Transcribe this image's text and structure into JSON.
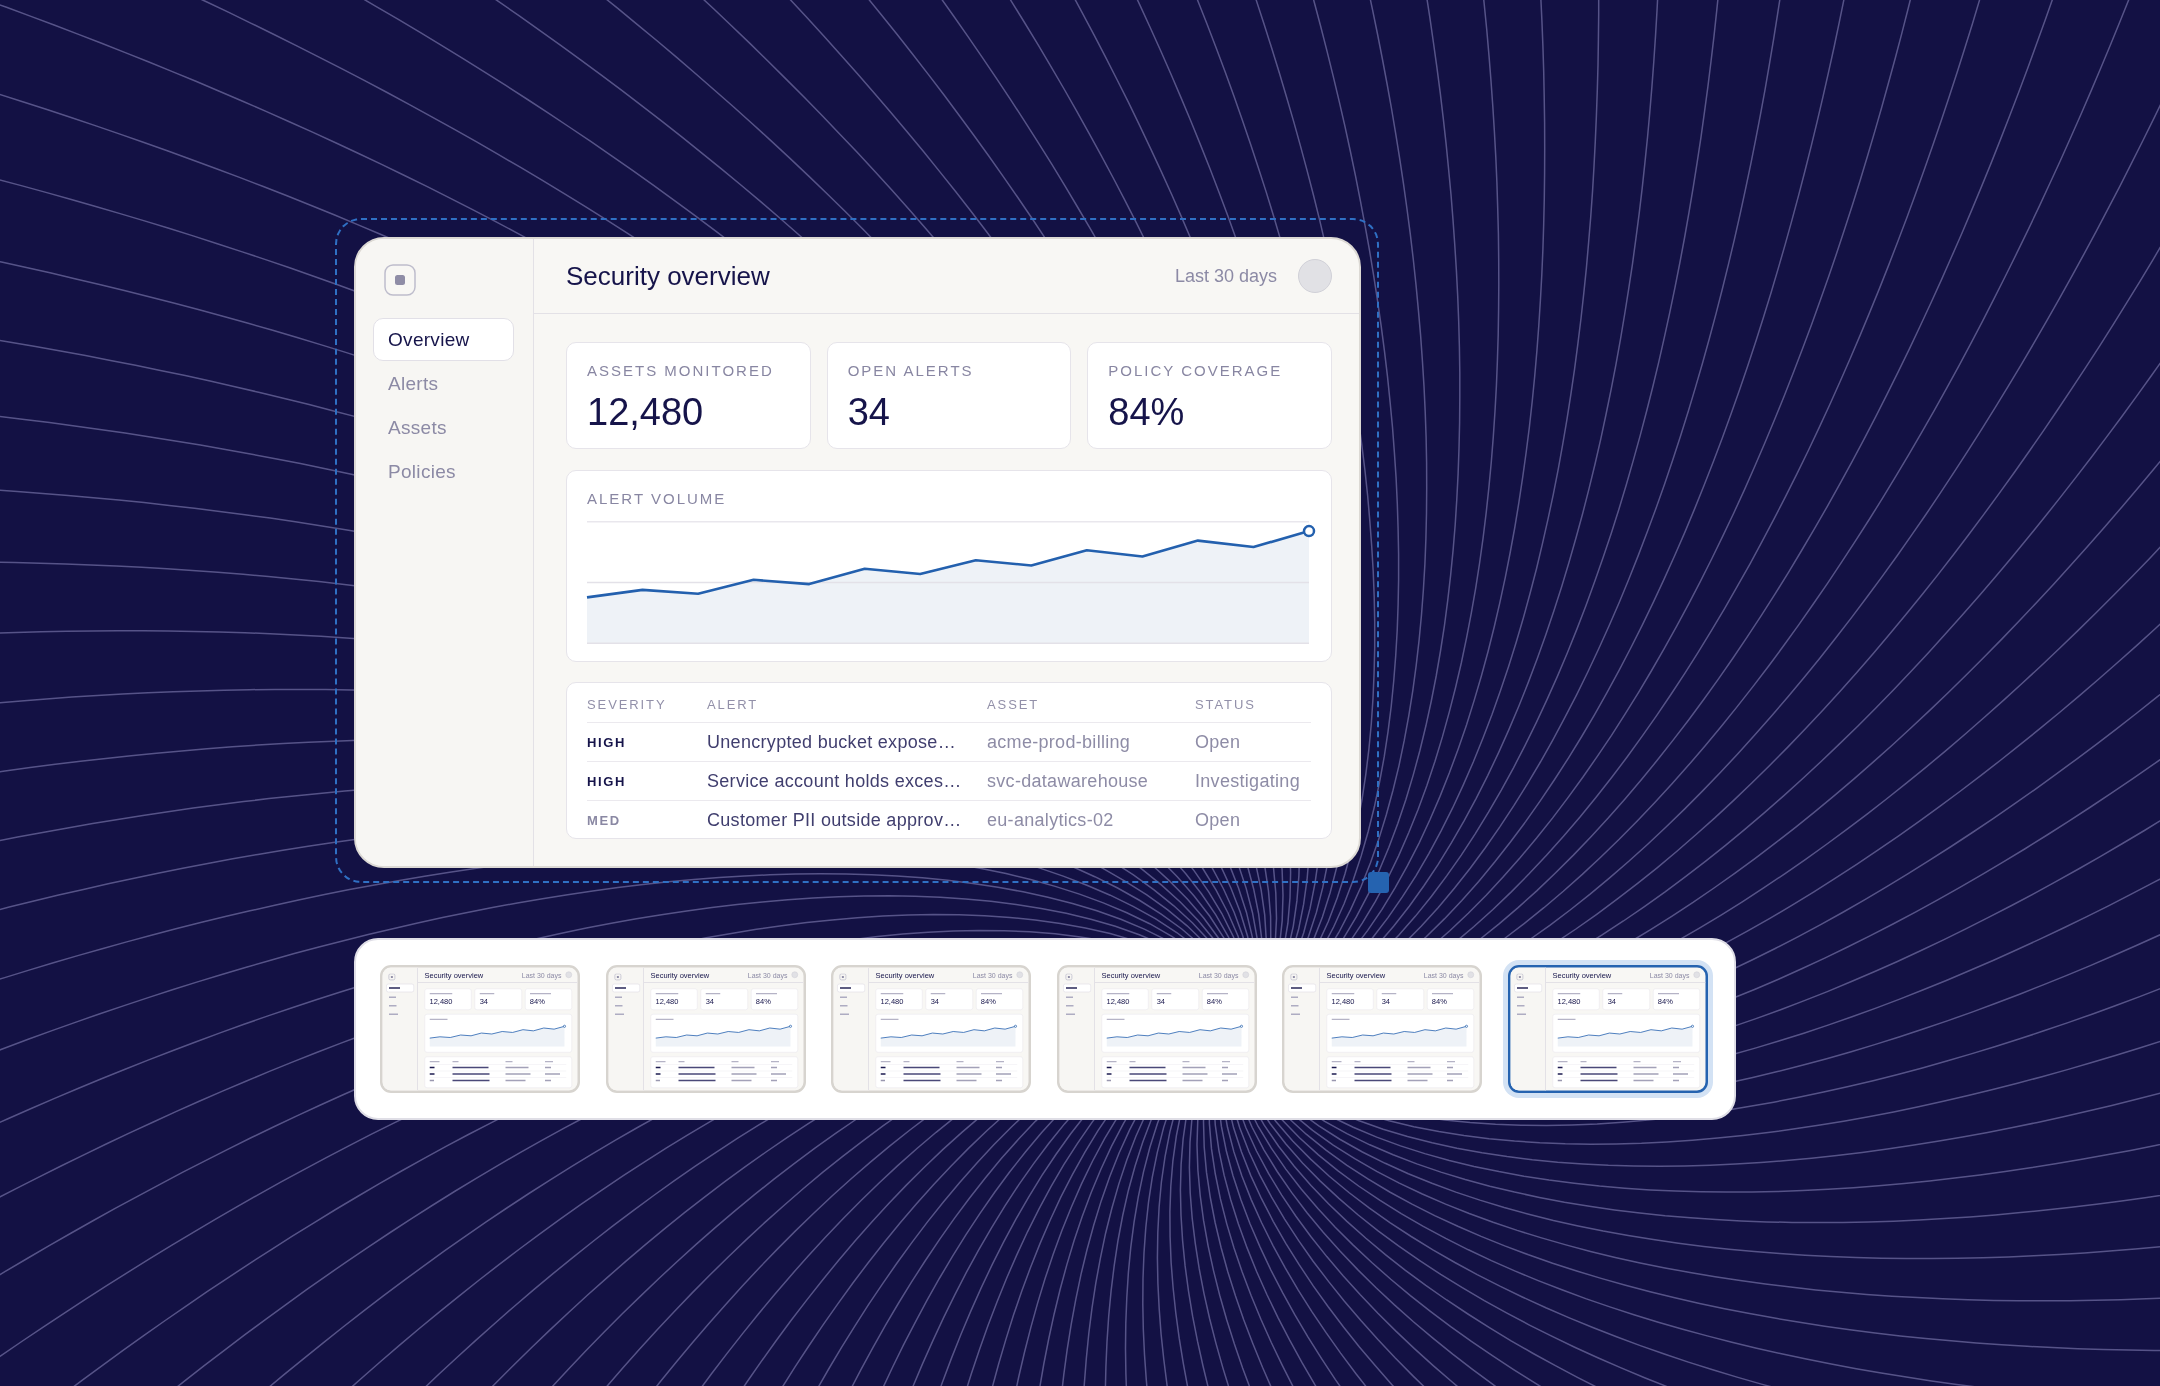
{
  "preview": {
    "selected": true,
    "sidebar": {
      "items": [
        {
          "label": "Overview",
          "selected": true
        },
        {
          "label": "Alerts",
          "selected": false
        },
        {
          "label": "Assets",
          "selected": false
        },
        {
          "label": "Policies",
          "selected": false
        }
      ]
    },
    "header": {
      "title": "Security overview",
      "range": "Last 30 days"
    },
    "stats": [
      {
        "label": "ASSETS MONITORED",
        "value": "12,480"
      },
      {
        "label": "OPEN ALERTS",
        "value": "34"
      },
      {
        "label": "POLICY COVERAGE",
        "value": "84%"
      }
    ],
    "alert_volume": {
      "title": "ALERT VOLUME"
    },
    "alerts_table": {
      "columns": [
        "SEVERITY",
        "ALERT",
        "ASSET",
        "STATUS"
      ],
      "rows": [
        {
          "severity": "HIGH",
          "kind": "high",
          "alert": "Unencrypted bucket expose…",
          "asset": "acme-prod-billing",
          "status": "Open"
        },
        {
          "severity": "HIGH",
          "kind": "high",
          "alert": "Service account holds exces…",
          "asset": "svc-datawarehouse",
          "status": "Investigating"
        },
        {
          "severity": "MED",
          "kind": "medium",
          "alert": "Customer PII outside approv…",
          "asset": "eu-analytics-02",
          "status": "Open"
        }
      ]
    }
  },
  "thumbnails": [
    {
      "title": "Security overview",
      "range": "Last 30 days",
      "stats": [
        "12,480",
        "34",
        "84%"
      ],
      "selected": false
    },
    {
      "title": "Security overview",
      "range": "Last 30 days",
      "stats": [
        "12,480",
        "34",
        "84%"
      ],
      "selected": false
    },
    {
      "title": "Security overview",
      "range": "Last 30 days",
      "stats": [
        "12,480",
        "34",
        "84%"
      ],
      "selected": false
    },
    {
      "title": "Security overview",
      "range": "Last 30 days",
      "stats": [
        "12,480",
        "34",
        "84%"
      ],
      "selected": false
    },
    {
      "title": "Security overview",
      "range": "Last 30 days",
      "stats": [
        "12,480",
        "34",
        "84%"
      ],
      "selected": false
    },
    {
      "title": "Security overview",
      "range": "Last 30 days",
      "stats": [
        "12,480",
        "34",
        "84%"
      ],
      "selected": true
    }
  ]
}
